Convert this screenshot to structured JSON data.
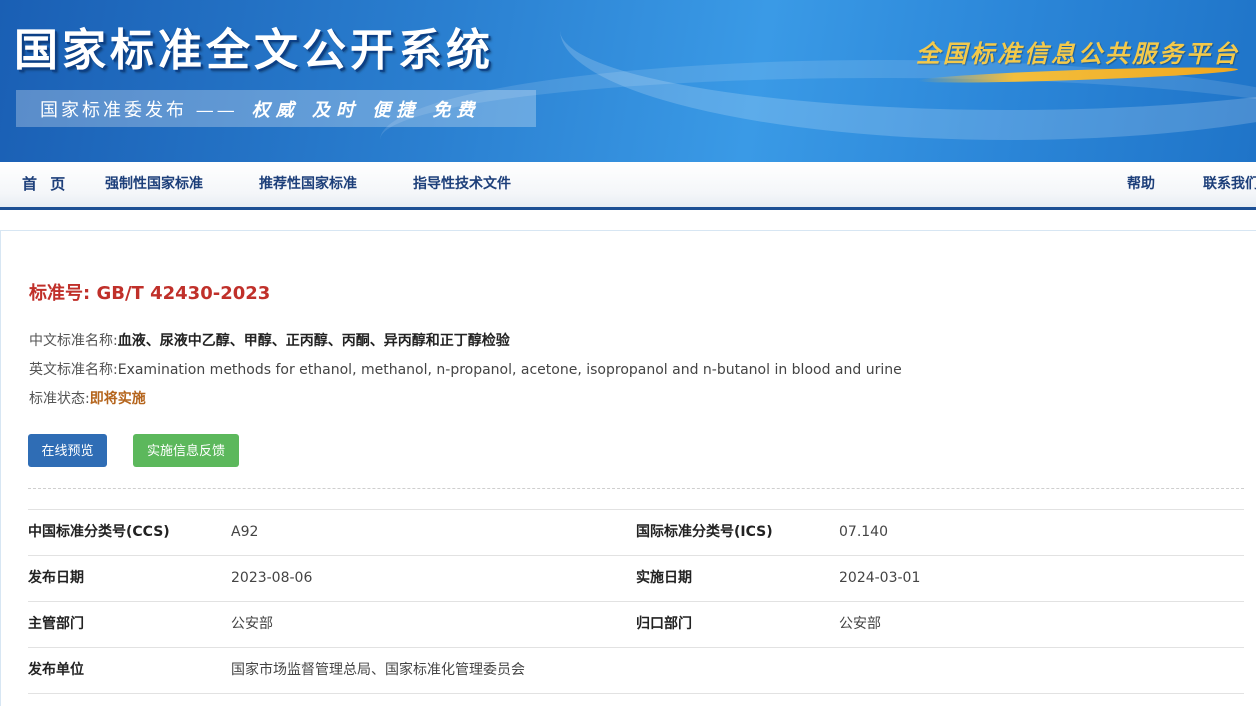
{
  "header": {
    "site_title": "国家标准全文公开系统",
    "publisher": "国家标准委发布 ——",
    "motto": "权威 及时 便捷 免费",
    "platform_name": "全国标准信息公共服务平台",
    "colors": {
      "banner": "#2a7fd0",
      "platform_text": "#f3c94b"
    }
  },
  "nav": {
    "home": "首 页",
    "mandatory": "强制性国家标准",
    "recommended": "推荐性国家标准",
    "guidance": "指导性技术文件",
    "help": "帮助",
    "contact": "联系我们"
  },
  "standard": {
    "number_label": "标准号:",
    "number": "GB/T 42430-2023",
    "cn_name_label": "中文标准名称:",
    "cn_name": "血液、尿液中乙醇、甲醇、正丙醇、丙酮、异丙醇和正丁醇检验",
    "en_name_label": "英文标准名称:",
    "en_name": "Examination methods for ethanol, methanol, n-propanol, acetone, isopropanol and n-butanol in blood and urine",
    "status_label": "标准状态:",
    "status": "即将实施",
    "colors": {
      "number": "#c0302a",
      "status": "#b5651d"
    }
  },
  "buttons": {
    "preview": "在线预览",
    "feedback": "实施信息反馈"
  },
  "meta": {
    "ccs_label": "中国标准分类号(CCS)",
    "ccs": "A92",
    "ics_label": "国际标准分类号(ICS)",
    "ics": "07.140",
    "publish_date_label": "发布日期",
    "publish_date": "2023-08-06",
    "implement_date_label": "实施日期",
    "implement_date": "2024-03-01",
    "authority_label": "主管部门",
    "authority": "公安部",
    "centralized_label": "归口部门",
    "centralized": "公安部",
    "issuer_label": "发布单位",
    "issuer": "国家市场监督管理总局、国家标准化管理委员会"
  }
}
